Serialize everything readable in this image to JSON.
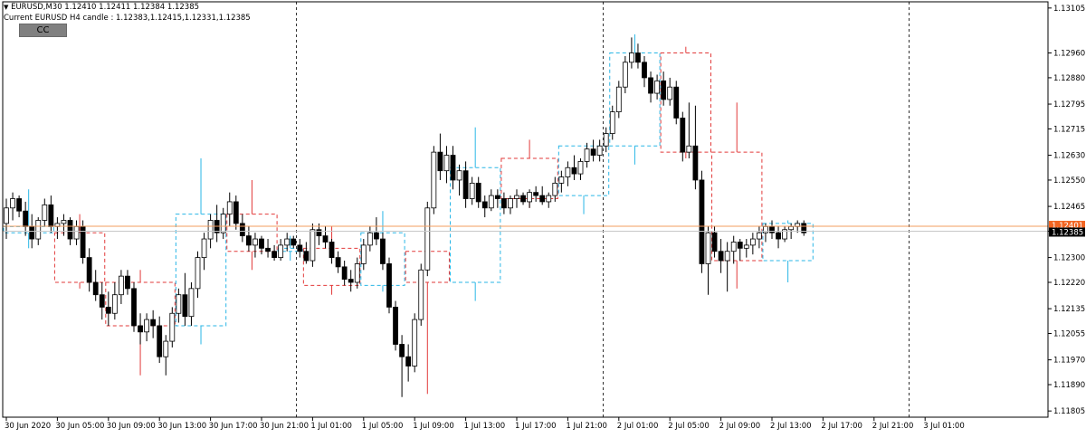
{
  "header": {
    "symbol_line": "EURUSD,M30  1.12410 1.12411 1.12384 1.12385",
    "candle_line": "Current EURUSD H4 candle : 1.12383,1.12415,1.12331,1.12385",
    "cc_button": "CC"
  },
  "colors": {
    "bull_candle": "#ffffff",
    "bear_candle": "#000000",
    "bull_h4_box": "#29b6e6",
    "bear_h4_box": "#e23a3a",
    "price_line_ask": "#f39c5f",
    "price_line_bid": "#c8c8c8",
    "ask_tag": "#f26522"
  },
  "chart_data": {
    "type": "candlestick",
    "symbol": "EURUSD",
    "timeframe": "M30",
    "overlay": "H4 candles",
    "ylim": [
      1.11785,
      1.13125
    ],
    "y_ticks": [
      "1.13105",
      "1.12960",
      "1.12880",
      "1.12795",
      "1.12715",
      "1.12630",
      "1.12550",
      "1.12465",
      "1.12385",
      "1.12300",
      "1.12220",
      "1.12135",
      "1.12055",
      "1.11970",
      "1.11890",
      "1.11805"
    ],
    "x_labels": [
      "30 Jun 2020",
      "30 Jun 05:00",
      "30 Jun 09:00",
      "30 Jun 13:00",
      "30 Jun 17:00",
      "30 Jun 21:00",
      "1 Jul 01:00",
      "1 Jul 05:00",
      "1 Jul 09:00",
      "1 Jul 13:00",
      "1 Jul 17:00",
      "1 Jul 21:00",
      "2 Jul 01:00",
      "2 Jul 05:00",
      "2 Jul 09:00",
      "2 Jul 13:00",
      "2 Jul 17:00",
      "2 Jul 21:00",
      "3 Jul 01:00"
    ],
    "day_separators": [
      "1 Jul 2020",
      "2 Jul 2020",
      "3 Jul 2020"
    ],
    "current_ask": "1.12401",
    "current_bid": "1.12385",
    "candles": [
      [
        1.1241,
        1.1249,
        1.1236,
        1.1246
      ],
      [
        1.1246,
        1.1251,
        1.1242,
        1.1249
      ],
      [
        1.1249,
        1.125,
        1.1243,
        1.1245
      ],
      [
        1.1245,
        1.1248,
        1.1237,
        1.124
      ],
      [
        1.124,
        1.1244,
        1.1233,
        1.1236
      ],
      [
        1.1236,
        1.1243,
        1.1234,
        1.1242
      ],
      [
        1.1242,
        1.1249,
        1.124,
        1.1247
      ],
      [
        1.1247,
        1.125,
        1.1238,
        1.124
      ],
      [
        1.124,
        1.1243,
        1.1236,
        1.1241
      ],
      [
        1.1241,
        1.1244,
        1.1237,
        1.1242
      ],
      [
        1.1242,
        1.1243,
        1.1234,
        1.1236
      ],
      [
        1.1236,
        1.1242,
        1.1234,
        1.124
      ],
      [
        1.124,
        1.1242,
        1.1228,
        1.123
      ],
      [
        1.123,
        1.1233,
        1.1219,
        1.1222
      ],
      [
        1.1222,
        1.1226,
        1.1216,
        1.1218
      ],
      [
        1.1218,
        1.1222,
        1.121,
        1.1214
      ],
      [
        1.1214,
        1.1219,
        1.1208,
        1.1212
      ],
      [
        1.1212,
        1.1222,
        1.121,
        1.1218
      ],
      [
        1.1218,
        1.1226,
        1.1215,
        1.1224
      ],
      [
        1.1224,
        1.1226,
        1.1218,
        1.122
      ],
      [
        1.122,
        1.1222,
        1.1206,
        1.1208
      ],
      [
        1.1208,
        1.1212,
        1.1202,
        1.1206
      ],
      [
        1.1206,
        1.1212,
        1.1203,
        1.121
      ],
      [
        1.121,
        1.1213,
        1.1204,
        1.1208
      ],
      [
        1.1208,
        1.1211,
        1.1196,
        1.1198
      ],
      [
        1.1198,
        1.1205,
        1.1192,
        1.1203
      ],
      [
        1.1203,
        1.1214,
        1.1201,
        1.1212
      ],
      [
        1.1212,
        1.122,
        1.1209,
        1.1218
      ],
      [
        1.1218,
        1.1225,
        1.1208,
        1.1211
      ],
      [
        1.1211,
        1.1222,
        1.1208,
        1.122
      ],
      [
        1.122,
        1.1232,
        1.1217,
        1.123
      ],
      [
        1.123,
        1.1238,
        1.1226,
        1.1236
      ],
      [
        1.1236,
        1.1244,
        1.1233,
        1.1242
      ],
      [
        1.1242,
        1.1247,
        1.1235,
        1.1238
      ],
      [
        1.1238,
        1.1246,
        1.1236,
        1.1244
      ],
      [
        1.1244,
        1.1251,
        1.124,
        1.1248
      ],
      [
        1.1248,
        1.125,
        1.1239,
        1.1241
      ],
      [
        1.1241,
        1.1244,
        1.1235,
        1.1237
      ],
      [
        1.1237,
        1.124,
        1.1232,
        1.1234
      ],
      [
        1.1234,
        1.1238,
        1.123,
        1.1236
      ],
      [
        1.1236,
        1.1237,
        1.1231,
        1.1233
      ],
      [
        1.1233,
        1.1236,
        1.123,
        1.1232
      ],
      [
        1.1232,
        1.1234,
        1.1229,
        1.123
      ],
      [
        1.123,
        1.1236,
        1.1229,
        1.1234
      ],
      [
        1.1234,
        1.1238,
        1.1232,
        1.1236
      ],
      [
        1.1236,
        1.1237,
        1.1233,
        1.1234
      ],
      [
        1.1234,
        1.1236,
        1.123,
        1.1232
      ],
      [
        1.1232,
        1.1235,
        1.1228,
        1.1229
      ],
      [
        1.1229,
        1.1241,
        1.1227,
        1.1239
      ],
      [
        1.1239,
        1.1241,
        1.1234,
        1.1237
      ],
      [
        1.1237,
        1.124,
        1.1233,
        1.1235
      ],
      [
        1.1235,
        1.1236,
        1.1228,
        1.123
      ],
      [
        1.123,
        1.1232,
        1.1225,
        1.1227
      ],
      [
        1.1227,
        1.1229,
        1.1221,
        1.1223
      ],
      [
        1.1223,
        1.1226,
        1.1219,
        1.1222
      ],
      [
        1.1222,
        1.123,
        1.122,
        1.1228
      ],
      [
        1.1228,
        1.1236,
        1.1226,
        1.1234
      ],
      [
        1.1234,
        1.124,
        1.1232,
        1.1238
      ],
      [
        1.1238,
        1.1243,
        1.1234,
        1.1236
      ],
      [
        1.1236,
        1.1238,
        1.1226,
        1.1228
      ],
      [
        1.1228,
        1.123,
        1.1212,
        1.1214
      ],
      [
        1.1214,
        1.1216,
        1.12,
        1.1202
      ],
      [
        1.1202,
        1.1205,
        1.1185,
        1.1198
      ],
      [
        1.1198,
        1.1202,
        1.119,
        1.1195
      ],
      [
        1.1195,
        1.1212,
        1.1193,
        1.121
      ],
      [
        1.121,
        1.1228,
        1.1208,
        1.1226
      ],
      [
        1.1226,
        1.1248,
        1.1224,
        1.1246
      ],
      [
        1.1246,
        1.1266,
        1.1244,
        1.1264
      ],
      [
        1.1264,
        1.127,
        1.1255,
        1.1258
      ],
      [
        1.1258,
        1.1266,
        1.1254,
        1.1263
      ],
      [
        1.1263,
        1.1266,
        1.1252,
        1.1255
      ],
      [
        1.1255,
        1.126,
        1.125,
        1.1258
      ],
      [
        1.1258,
        1.1261,
        1.1246,
        1.1249
      ],
      [
        1.1249,
        1.1256,
        1.1247,
        1.1254
      ],
      [
        1.1254,
        1.1256,
        1.1246,
        1.1248
      ],
      [
        1.1248,
        1.125,
        1.1243,
        1.1246
      ],
      [
        1.1246,
        1.1252,
        1.1245,
        1.125
      ],
      [
        1.125,
        1.1252,
        1.1246,
        1.1249
      ],
      [
        1.1249,
        1.1251,
        1.1244,
        1.1246
      ],
      [
        1.1246,
        1.125,
        1.1244,
        1.1249
      ],
      [
        1.1249,
        1.1252,
        1.1246,
        1.125
      ],
      [
        1.125,
        1.1251,
        1.1247,
        1.1248
      ],
      [
        1.1248,
        1.1252,
        1.1246,
        1.1251
      ],
      [
        1.1251,
        1.1253,
        1.1248,
        1.125
      ],
      [
        1.125,
        1.1253,
        1.1247,
        1.1248
      ],
      [
        1.1248,
        1.1251,
        1.1246,
        1.125
      ],
      [
        1.125,
        1.1256,
        1.1248,
        1.1254
      ],
      [
        1.1254,
        1.1258,
        1.1251,
        1.1256
      ],
      [
        1.1256,
        1.1261,
        1.1253,
        1.1259
      ],
      [
        1.1259,
        1.1263,
        1.1255,
        1.1257
      ],
      [
        1.1257,
        1.1262,
        1.1255,
        1.1261
      ],
      [
        1.1261,
        1.1267,
        1.1259,
        1.1265
      ],
      [
        1.1265,
        1.1268,
        1.1261,
        1.1263
      ],
      [
        1.1263,
        1.1268,
        1.1261,
        1.1266
      ],
      [
        1.1266,
        1.1272,
        1.1264,
        1.127
      ],
      [
        1.127,
        1.1279,
        1.1268,
        1.1277
      ],
      [
        1.1277,
        1.1287,
        1.1275,
        1.1285
      ],
      [
        1.1285,
        1.1295,
        1.1283,
        1.1293
      ],
      [
        1.1293,
        1.1301,
        1.1291,
        1.1296
      ],
      [
        1.1296,
        1.1299,
        1.1291,
        1.1293
      ],
      [
        1.1293,
        1.1295,
        1.1285,
        1.1288
      ],
      [
        1.1288,
        1.129,
        1.128,
        1.1283
      ],
      [
        1.1283,
        1.1289,
        1.1281,
        1.1287
      ],
      [
        1.1287,
        1.129,
        1.1279,
        1.1281
      ],
      [
        1.1281,
        1.1288,
        1.1279,
        1.1285
      ],
      [
        1.1285,
        1.1287,
        1.1273,
        1.1275
      ],
      [
        1.1275,
        1.1277,
        1.1261,
        1.1264
      ],
      [
        1.1264,
        1.128,
        1.1262,
        1.1266
      ],
      [
        1.1266,
        1.1279,
        1.1252,
        1.1255
      ],
      [
        1.1255,
        1.1258,
        1.1225,
        1.1228
      ],
      [
        1.1228,
        1.124,
        1.1218,
        1.1238
      ],
      [
        1.1238,
        1.124,
        1.123,
        1.1232
      ],
      [
        1.1232,
        1.1236,
        1.1225,
        1.1229
      ],
      [
        1.1229,
        1.1235,
        1.1219,
        1.1232
      ],
      [
        1.1232,
        1.1237,
        1.1228,
        1.1235
      ],
      [
        1.1235,
        1.1236,
        1.1229,
        1.1233
      ],
      [
        1.1233,
        1.1236,
        1.123,
        1.1234
      ],
      [
        1.1234,
        1.1238,
        1.1231,
        1.1236
      ],
      [
        1.1236,
        1.124,
        1.1233,
        1.1238
      ],
      [
        1.1238,
        1.1241,
        1.1235,
        1.124
      ],
      [
        1.124,
        1.1242,
        1.1236,
        1.1238
      ],
      [
        1.1238,
        1.124,
        1.1233,
        1.1236
      ],
      [
        1.1236,
        1.124,
        1.1235,
        1.1239
      ],
      [
        1.1239,
        1.1241,
        1.1236,
        1.124
      ],
      [
        1.124,
        1.1242,
        1.1238,
        1.1241
      ],
      [
        1.1241,
        1.1242,
        1.1237,
        1.1238
      ]
    ],
    "h4_boxes": [
      {
        "bull": true,
        "o": 1.1238,
        "h": 1.1252,
        "l": 1.1233,
        "c": 1.124,
        "from": 0,
        "to": 7
      },
      {
        "bull": false,
        "o": 1.1238,
        "h": 1.1244,
        "l": 1.122,
        "c": 1.1222,
        "from": 8,
        "to": 15
      },
      {
        "bull": false,
        "o": 1.1222,
        "h": 1.1226,
        "l": 1.1192,
        "c": 1.1208,
        "from": 16,
        "to": 26
      },
      {
        "bull": true,
        "o": 1.1208,
        "h": 1.1262,
        "l": 1.1202,
        "c": 1.1244,
        "from": 27,
        "to": 34
      },
      {
        "bull": false,
        "o": 1.1244,
        "h": 1.1255,
        "l": 1.1226,
        "c": 1.1232,
        "from": 35,
        "to": 42
      },
      {
        "bull": true,
        "o": 1.1232,
        "h": 1.1237,
        "l": 1.1229,
        "c": 1.1233,
        "from": 43,
        "to": 46
      },
      {
        "bull": false,
        "o": 1.1233,
        "h": 1.124,
        "l": 1.1218,
        "c": 1.1221,
        "from": 47,
        "to": 55
      },
      {
        "bull": true,
        "o": 1.1221,
        "h": 1.1245,
        "l": 1.1219,
        "c": 1.1238,
        "from": 56,
        "to": 62
      },
      {
        "bull": false,
        "o": 1.1232,
        "h": 1.1246,
        "l": 1.1186,
        "c": 1.1222,
        "from": 63,
        "to": 69
      },
      {
        "bull": true,
        "o": 1.1222,
        "h": 1.1272,
        "l": 1.1216,
        "c": 1.1259,
        "from": 70,
        "to": 77
      },
      {
        "bull": false,
        "o": 1.1262,
        "h": 1.1268,
        "l": 1.1246,
        "c": 1.1249,
        "from": 78,
        "to": 86
      },
      {
        "bull": true,
        "o": 1.125,
        "h": 1.1266,
        "l": 1.1244,
        "c": 1.1266,
        "from": 87,
        "to": 94
      },
      {
        "bull": true,
        "o": 1.1266,
        "h": 1.1302,
        "l": 1.126,
        "c": 1.1296,
        "from": 95,
        "to": 102
      },
      {
        "bull": false,
        "o": 1.1296,
        "h": 1.1298,
        "l": 1.1262,
        "c": 1.1264,
        "from": 103,
        "to": 110
      },
      {
        "bull": false,
        "o": 1.1264,
        "h": 1.128,
        "l": 1.122,
        "c": 1.1229,
        "from": 111,
        "to": 118
      },
      {
        "bull": true,
        "o": 1.1229,
        "h": 1.1242,
        "l": 1.1222,
        "c": 1.1241,
        "from": 119,
        "to": 126
      }
    ]
  }
}
